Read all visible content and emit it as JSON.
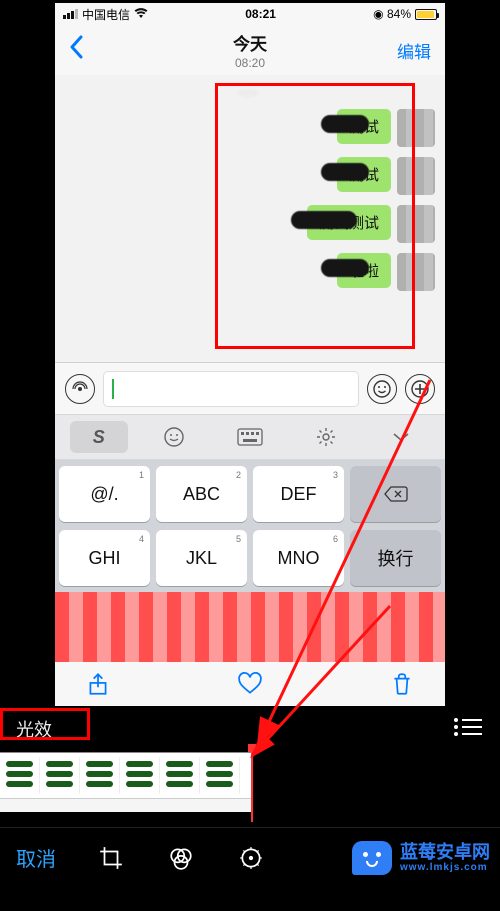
{
  "statusbar": {
    "carrier": "中国电信",
    "time": "08:21",
    "battery_percent": "84%",
    "battery_icon": "battery-icon",
    "wifi_icon": "wifi-icon"
  },
  "nav": {
    "back_icon": "chevron-left-icon",
    "title": "今天",
    "subtitle": "08:20",
    "edit_label": "编辑"
  },
  "chat": {
    "timestamp_masked": "--:--",
    "messages": [
      {
        "text": "测试"
      },
      {
        "text": "测试"
      },
      {
        "text": "测试测试"
      },
      {
        "text": "啦啦"
      }
    ]
  },
  "inputbar": {
    "voice_icon": "voice-wave-icon",
    "emoji_icon": "smile-icon",
    "plus_icon": "plus-icon",
    "input_value": ""
  },
  "suggestion_row": {
    "items": [
      "S",
      "☺",
      "⌨",
      "⚙",
      "˅"
    ]
  },
  "keyboard": {
    "rows": [
      [
        {
          "num": "1",
          "letters": ""
        },
        {
          "num": "2",
          "letters": "ABC"
        },
        {
          "num": "3",
          "letters": "DEF"
        },
        {
          "type": "backspace"
        }
      ],
      [
        {
          "num": "4",
          "letters": "GHI"
        },
        {
          "num": "5",
          "letters": "JKL"
        },
        {
          "num": "6",
          "letters": "MNO"
        },
        {
          "type": "return",
          "label": "换行"
        }
      ]
    ],
    "special_key": "@/."
  },
  "phone_bottom": {
    "share_icon": "share-icon",
    "heart_icon": "heart-icon",
    "trash_icon": "trash-icon"
  },
  "editor": {
    "effect_label": "光效",
    "cancel_label": "取消",
    "crop_icon": "crop-icon",
    "filter_icon": "filter-circles-icon",
    "adjust_icon": "dial-icon",
    "menu_icon": "list-icon"
  },
  "watermark": {
    "line1": "蓝莓安卓网",
    "line2": "www.lmkjs.com"
  },
  "annotations": {
    "red_box_chat": "highlight-box",
    "red_box_effect": "highlight-box",
    "arrow": "pointer-arrow"
  }
}
